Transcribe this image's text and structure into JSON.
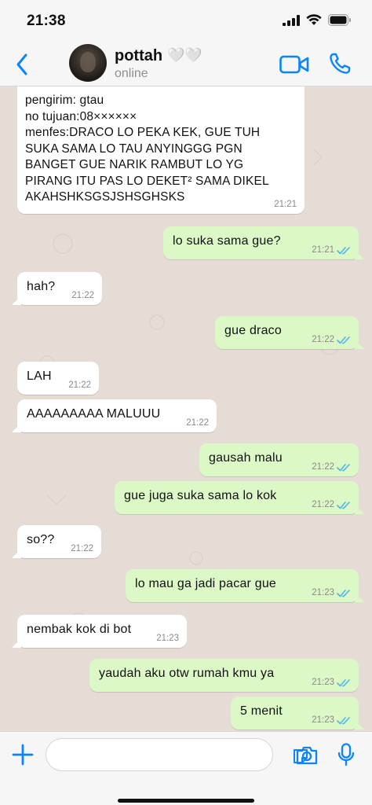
{
  "status_bar": {
    "time": "21:38"
  },
  "header": {
    "back_icon": "chevron-left-icon",
    "contact_name": "pottah",
    "contact_emoji": "🤍🤍",
    "contact_status": "online",
    "video_icon": "video-camera-icon",
    "call_icon": "phone-icon"
  },
  "messages": [
    {
      "direction": "in",
      "lines": [
        "pengirim: gtau",
        "no tujuan:08××××××",
        "menfes:DRACO LO PEKA KEK, GUE TUH",
        "SUKA SAMA LO TAU ANYINGGG PGN",
        "BANGET GUE NARIK RAMBUT LO YG",
        "PIRANG ITU PAS LO DEKET² SAMA DIKEL",
        "AKAHSHKSGSJSHSGHSKS"
      ],
      "time": "21:21"
    },
    {
      "direction": "out",
      "text": "lo suka sama gue?",
      "time": "21:21",
      "read": true
    },
    {
      "direction": "in",
      "text": "hah?",
      "time": "21:22"
    },
    {
      "direction": "out",
      "text": "gue draco",
      "time": "21:22",
      "read": true
    },
    {
      "direction": "in",
      "text": "LAH",
      "time": "21:22"
    },
    {
      "direction": "in",
      "text": "AAAAAAAAA MALUUU",
      "time": "21:22"
    },
    {
      "direction": "out",
      "text": "gausah malu",
      "time": "21:22",
      "read": true
    },
    {
      "direction": "out",
      "text": "gue juga suka sama lo kok",
      "time": "21:22",
      "read": true
    },
    {
      "direction": "in",
      "text": "so??",
      "time": "21:22"
    },
    {
      "direction": "out",
      "text": "lo mau ga jadi pacar gue",
      "time": "21:23",
      "read": true
    },
    {
      "direction": "in",
      "text": "nembak kok di bot",
      "time": "21:23"
    },
    {
      "direction": "out",
      "text": "yaudah aku otw rumah kmu ya",
      "time": "21:23",
      "read": true
    },
    {
      "direction": "out",
      "text": "5 menit",
      "time": "21:23",
      "read": true
    }
  ],
  "input_bar": {
    "message_value": "",
    "plus_icon": "plus-icon",
    "sticker_icon": "sticker-icon",
    "camera_icon": "camera-icon",
    "mic_icon": "microphone-icon"
  },
  "colors": {
    "accent": "#0a84ff",
    "outgoing_bubble": "#dcf8c6",
    "incoming_bubble": "#ffffff",
    "chat_background": "#e5ddd5",
    "read_ticks": "#4fb6ec"
  }
}
